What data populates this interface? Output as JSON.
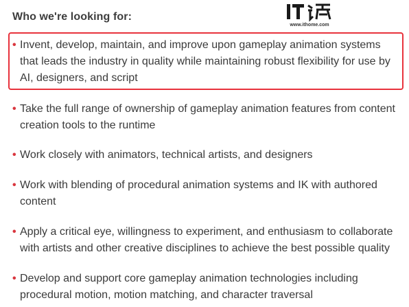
{
  "section": {
    "heading": "Who we're looking for:"
  },
  "watermark": {
    "logo_text": "IT之家",
    "url": "www.ithome.com"
  },
  "colors": {
    "highlight_border": "#e8323c",
    "bullet": "#d9363e",
    "text": "#3a3a3a"
  },
  "bullet_glyph": "•",
  "items": [
    {
      "text": "Invent, develop, maintain, and improve upon gameplay animation systems that leads the industry in quality while maintaining robust flexibility for use by AI, designers, and script",
      "highlighted": true
    },
    {
      "text": "Take the full range of ownership of gameplay animation features from content creation tools to the runtime",
      "highlighted": false
    },
    {
      "text": "Work closely with animators, technical artists, and designers",
      "highlighted": false
    },
    {
      "text": "Work with blending of procedural animation systems and IK with authored content",
      "highlighted": false
    },
    {
      "text": "Apply a critical eye, willingness to experiment, and enthusiasm to collaborate with artists and other creative disciplines to achieve the best possible quality",
      "highlighted": false
    },
    {
      "text": "Develop and support core gameplay animation technologies including procedural motion, motion matching, and character traversal",
      "highlighted": false
    }
  ]
}
